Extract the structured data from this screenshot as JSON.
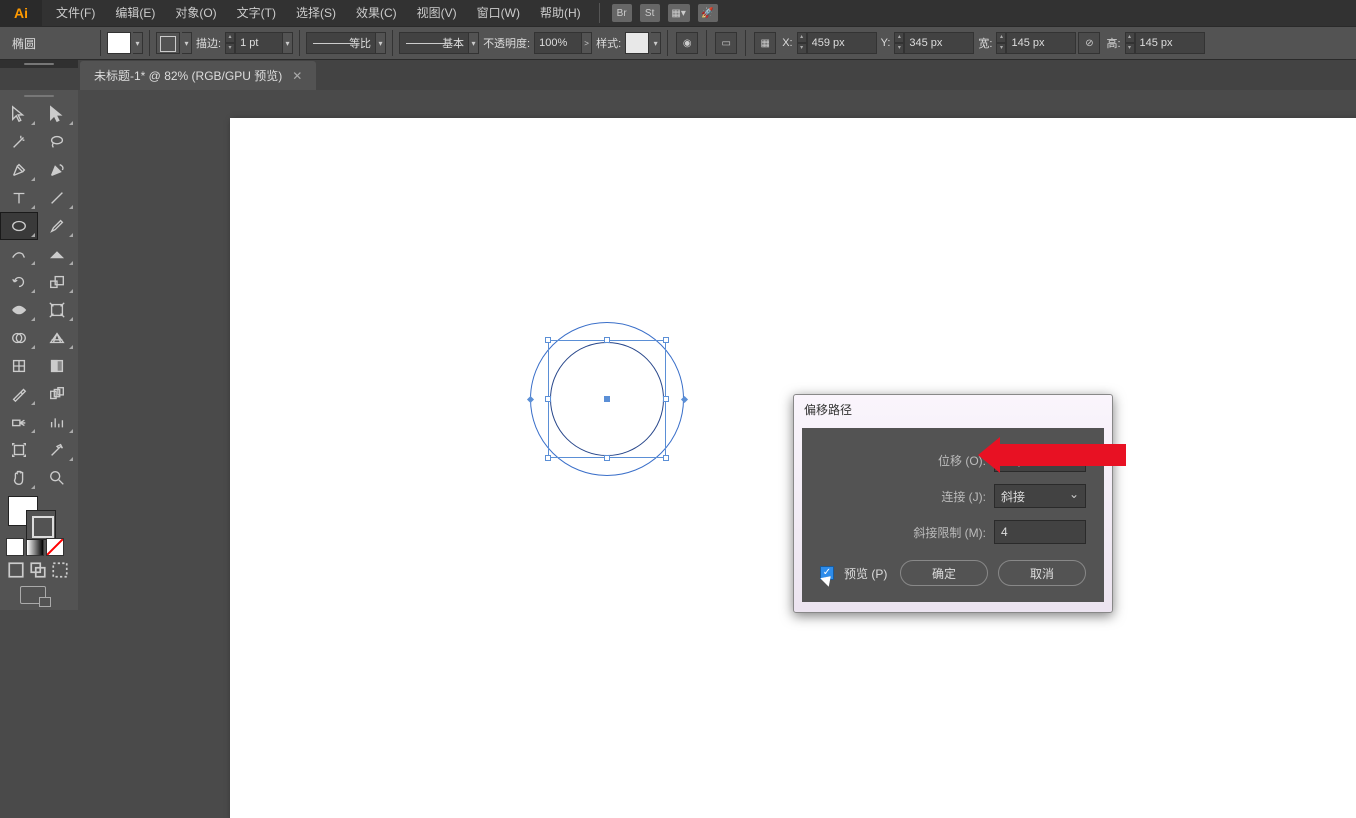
{
  "app": {
    "logo": "Ai"
  },
  "menu": {
    "file": "文件(F)",
    "edit": "编辑(E)",
    "object": "对象(O)",
    "type": "文字(T)",
    "select": "选择(S)",
    "effect": "效果(C)",
    "view": "视图(V)",
    "window": "窗口(W)",
    "help": "帮助(H)"
  },
  "doc": {
    "tab_title": "未标题-1* @ 82% (RGB/GPU 预览)"
  },
  "controlbar": {
    "shape_label": "椭圆",
    "stroke_label": "描边:",
    "stroke_weight": "1 pt",
    "brush_uniform": "等比",
    "brush_basic": "基本",
    "opacity_label": "不透明度:",
    "opacity_value": "100%",
    "style_label": "样式:",
    "x_label": "X:",
    "x_value": "459 px",
    "y_label": "Y:",
    "y_value": "345 px",
    "w_label": "宽:",
    "w_value": "145 px",
    "h_label": "高:",
    "h_value": "145 px"
  },
  "menu_icons": {
    "br": "Br",
    "st": "St"
  },
  "dialog": {
    "title": "偏移路径",
    "offset_label": "位移 (O):",
    "offset_value": "20 px",
    "join_label": "连接 (J):",
    "join_value": "斜接",
    "miter_label": "斜接限制 (M):",
    "miter_value": "4",
    "preview_label": "预览 (P)",
    "ok": "确定",
    "cancel": "取消"
  }
}
